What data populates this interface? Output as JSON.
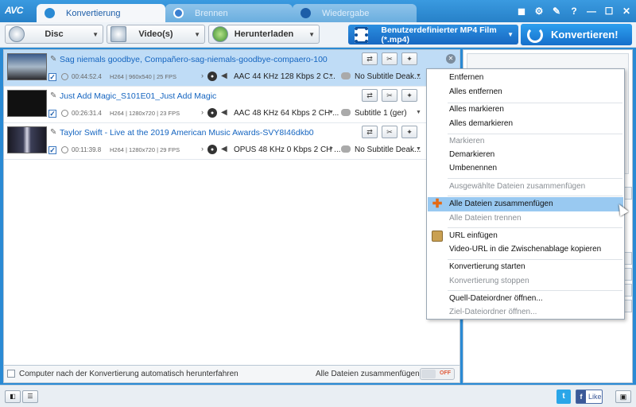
{
  "app": {
    "logo": "AVC",
    "tabs": [
      {
        "label": "Konvertierung",
        "active": true
      },
      {
        "label": "Brennen",
        "active": false
      },
      {
        "label": "Wiedergabe",
        "active": false
      }
    ],
    "window_controls": [
      "◼",
      "⚙",
      "✎",
      "?",
      "—",
      "☐",
      "✕"
    ]
  },
  "toolbar": {
    "disc_label": "Disc",
    "videos_label": "Video(s)",
    "download_label": "Herunterladen",
    "format_label": "Benutzerdefinierter MP4 Film (*.mp4)",
    "convert_label": "Konvertieren!"
  },
  "items": [
    {
      "title": "Sag niemals goodbye, Compañero-sag-niemals-goodbye-compaero-100",
      "duration": "00:44:52.4",
      "video_info": "H264 | 960x540 | 25 FPS",
      "audio": "AAC 44 KHz 128 Kbps 2 C...",
      "subtitle": "No Subtitle Deak...",
      "selected": true
    },
    {
      "title": "Just Add Magic_S101E01_Just Add Magic",
      "duration": "00:26:31.4",
      "video_info": "H264 | 1280x720 | 23 FPS",
      "audio": "AAC 48 KHz 64 Kbps 2 CH ...",
      "subtitle": "Subtitle 1 (ger)",
      "selected": false
    },
    {
      "title": "Taylor Swift - Live at the 2019 American Music Awards-SVY8I46dkb0",
      "duration": "00:11:39.8",
      "video_info": "H264 | 1280x720 | 29 FPS",
      "audio": "OPUS 48 KHz 0 Kbps 2 CH ...",
      "subtitle": "No Subtitle Deak...",
      "selected": false
    }
  ],
  "status": {
    "auto_shutdown_label": "Computer nach der Konvertierung automatisch herunterfahren",
    "merge_label": "Alle Dateien zusammenfügen",
    "toggle_label": "OFF"
  },
  "context_menu": {
    "items": [
      {
        "label": "Entfernen",
        "enabled": true
      },
      {
        "label": "Alles entfernen",
        "enabled": true
      },
      {
        "label": "Alles markieren",
        "enabled": true
      },
      {
        "label": "Alles demarkieren",
        "enabled": true
      },
      {
        "label": "Markieren",
        "enabled": false
      },
      {
        "label": "Demarkieren",
        "enabled": true
      },
      {
        "label": "Umbenennen",
        "enabled": true
      },
      {
        "label": "Ausgewählte Dateien zusammenfügen",
        "enabled": false
      },
      {
        "label": "Alle Dateien zusammenfügen",
        "enabled": true,
        "highlighted": true
      },
      {
        "label": "Alle Dateien trennen",
        "enabled": false
      },
      {
        "label": "URL einfügen",
        "enabled": true
      },
      {
        "label": "Video-URL in die Zwischenablage kopieren",
        "enabled": true
      },
      {
        "label": "Konvertierung starten",
        "enabled": true
      },
      {
        "label": "Konvertierung stoppen",
        "enabled": false
      },
      {
        "label": "Quell-Dateiordner öffnen...",
        "enabled": true
      },
      {
        "label": "Ziel-Dateiordner öffnen...",
        "enabled": false
      }
    ]
  },
  "footer": {
    "twitter": "t",
    "fb_like": "Like"
  },
  "colors": {
    "accent": "#2a8ad4",
    "link": "#1565c0",
    "selected_row": "#bfdcf6",
    "menu_highlight": "#99c9f1"
  }
}
